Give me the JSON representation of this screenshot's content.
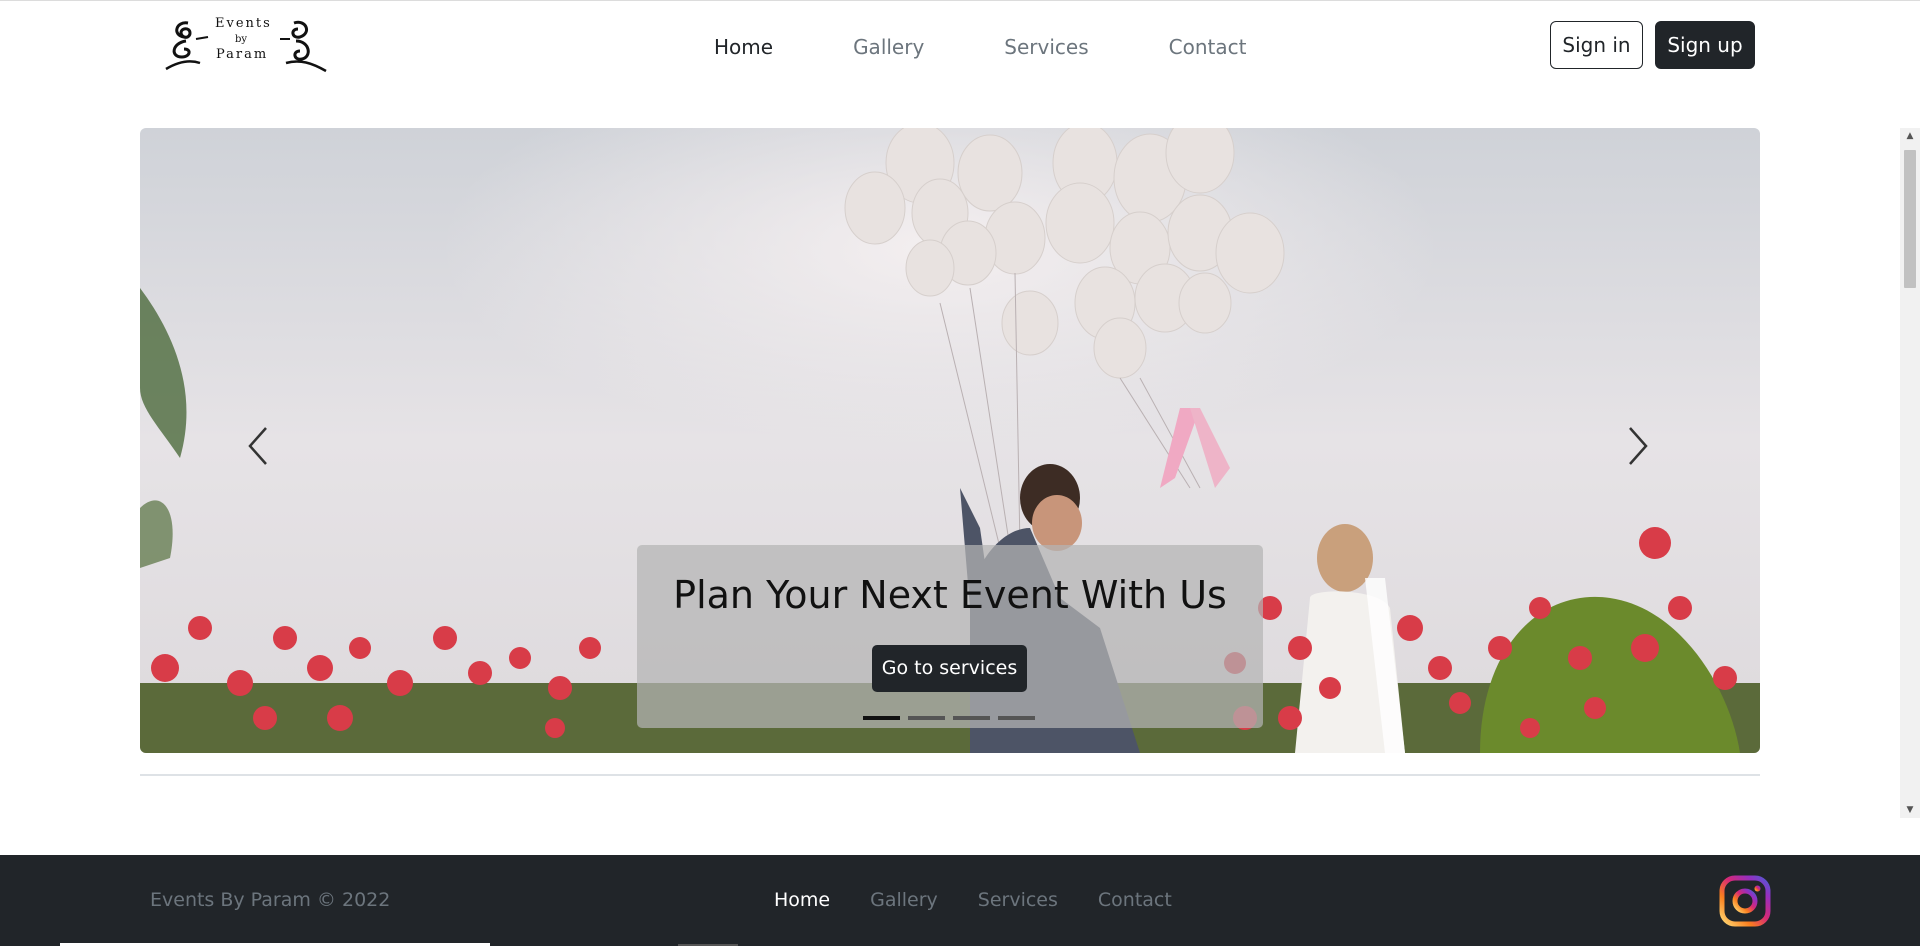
{
  "brand": {
    "logo_line1": "Events",
    "logo_line2": "by",
    "logo_line3": "Param"
  },
  "nav": {
    "items": [
      {
        "label": "Home",
        "active": true
      },
      {
        "label": "Gallery",
        "active": false
      },
      {
        "label": "Services",
        "active": false
      },
      {
        "label": "Contact",
        "active": false
      }
    ]
  },
  "auth": {
    "signin_label": "Sign in",
    "signup_label": "Sign up"
  },
  "carousel": {
    "caption_title": "Plan Your Next Event With Us",
    "caption_button": "Go to services",
    "slide_count": 4,
    "active_slide": 1,
    "prev_icon": "chevron-left-icon",
    "next_icon": "chevron-right-icon"
  },
  "footer": {
    "copyright": "Events By Param © 2022",
    "nav": [
      {
        "label": "Home",
        "active": true
      },
      {
        "label": "Gallery",
        "active": false
      },
      {
        "label": "Services",
        "active": false
      },
      {
        "label": "Contact",
        "active": false
      }
    ],
    "social_icon": "instagram-icon"
  },
  "colors": {
    "dark": "#212529",
    "muted": "#6c757d",
    "white": "#ffffff"
  }
}
